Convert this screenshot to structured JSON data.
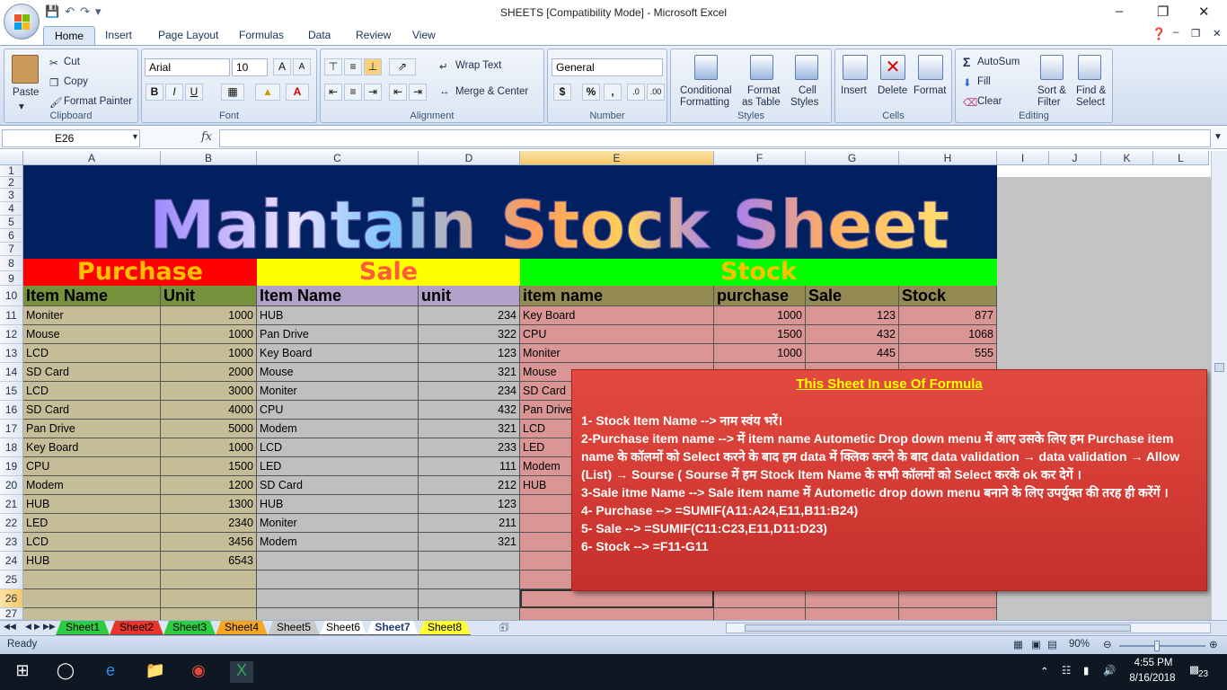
{
  "window": {
    "title": "SHEETS  [Compatibility Mode] - Microsoft Excel"
  },
  "tabs": [
    "Home",
    "Insert",
    "Page Layout",
    "Formulas",
    "Data",
    "Review",
    "View"
  ],
  "ribbon": {
    "clipboard": {
      "label": "Clipboard",
      "paste": "Paste",
      "cut": "Cut",
      "copy": "Copy",
      "format_painter": "Format Painter"
    },
    "font": {
      "label": "Font",
      "font_name": "Arial",
      "font_size": "10",
      "bold": "B",
      "italic": "I",
      "underline": "U"
    },
    "alignment": {
      "label": "Alignment",
      "wrap_text": "Wrap Text",
      "merge_center": "Merge & Center"
    },
    "number": {
      "label": "Number",
      "format": "General",
      "currency": "$",
      "percent": "%",
      "comma": ","
    },
    "styles": {
      "label": "Styles",
      "conditional": "Conditional",
      "formatting": "Formatting",
      "format": "Format",
      "as_table": "as Table",
      "cell": "Cell",
      "styles_word": "Styles"
    },
    "cells": {
      "label": "Cells",
      "insert": "Insert",
      "delete": "Delete",
      "format": "Format"
    },
    "editing": {
      "label": "Editing",
      "autosum": "AutoSum",
      "fill": "Fill",
      "clear": "Clear",
      "sort": "Sort &",
      "filter": "Filter",
      "find": "Find &",
      "select": "Select"
    }
  },
  "formula_bar": {
    "name_box": "E26",
    "fx": "fx",
    "value": ""
  },
  "columns": [
    "A",
    "B",
    "C",
    "D",
    "E",
    "F",
    "G",
    "H",
    "I",
    "J",
    "K",
    "L"
  ],
  "rows": [
    "1",
    "2",
    "3",
    "4",
    "5",
    "6",
    "7",
    "8",
    "9",
    "10",
    "11",
    "12",
    "13",
    "14",
    "15",
    "16",
    "17",
    "18",
    "19",
    "20",
    "21",
    "22",
    "23",
    "24",
    "25",
    "26",
    "27"
  ],
  "banner": {
    "title": "Maintain Stock Sheet"
  },
  "sections": {
    "purchase": "Purchase",
    "sale": "Sale",
    "stock": "Stock"
  },
  "headers": {
    "purchase": [
      "Item  Name",
      "Unit"
    ],
    "sale": [
      "Item Name",
      "unit"
    ],
    "stock": [
      "item name",
      "purchase",
      "Sale",
      "Stock"
    ]
  },
  "purchase_rows": [
    [
      "Moniter",
      "1000"
    ],
    [
      "Mouse",
      "1000"
    ],
    [
      "LCD",
      "1000"
    ],
    [
      "SD Card",
      "2000"
    ],
    [
      "LCD",
      "3000"
    ],
    [
      "SD Card",
      "4000"
    ],
    [
      "Pan Drive",
      "5000"
    ],
    [
      "Key Board",
      "1000"
    ],
    [
      "CPU",
      "1500"
    ],
    [
      "Modem",
      "1200"
    ],
    [
      "HUB",
      "1300"
    ],
    [
      "LED",
      "2340"
    ],
    [
      "LCD",
      "3456"
    ],
    [
      "HUB",
      "6543"
    ]
  ],
  "sale_rows": [
    [
      "HUB",
      "234"
    ],
    [
      "Pan Drive",
      "322"
    ],
    [
      "Key Board",
      "123"
    ],
    [
      "Mouse",
      "321"
    ],
    [
      "Moniter",
      "234"
    ],
    [
      "CPU",
      "432"
    ],
    [
      "Modem",
      "321"
    ],
    [
      "LCD",
      "233"
    ],
    [
      "LED",
      "111"
    ],
    [
      "SD Card",
      "212"
    ],
    [
      "HUB",
      "123"
    ],
    [
      "Moniter",
      "211"
    ],
    [
      "Modem",
      "321"
    ]
  ],
  "stock_rows": [
    [
      "Key Board",
      "1000",
      "123",
      "877"
    ],
    [
      "CPU",
      "1500",
      "432",
      "1068"
    ],
    [
      "Moniter",
      "1000",
      "445",
      "555"
    ],
    [
      "Mouse",
      "",
      "",
      ""
    ],
    [
      "SD Card",
      "",
      "",
      ""
    ],
    [
      "Pan Drive",
      "",
      "",
      ""
    ],
    [
      "LCD",
      "",
      "",
      ""
    ],
    [
      "LED",
      "",
      "",
      ""
    ],
    [
      "Modem",
      "",
      "",
      ""
    ],
    [
      "HUB",
      "",
      "",
      ""
    ]
  ],
  "note": {
    "title": "This  Sheet In use Of Formula",
    "lines": [
      "1- Stock Item Name    -->   नाम स्वंय भरें।",
      "2-Purchase item name    --> में item name Autometic Drop down menu  में आए उसके लिए   हम Purchase item name के कॉलमों को Select करने के बाद हम data  में  क्लिक करने के बाद data validation  → data validation  → Allow (List)  → Sourse ( Sourse में हम Stock Item Name के सभी कॉलमों को  Select करके ok  कर देगें ।",
      "3-Sale itme Name -->  Sale item name में Autometic drop down menu बनाने के लिए उपर्युक्त की तरह ही करेंगें ।",
      "4- Purchase --> =SUMIF(A11:A24,E11,B11:B24)",
      "5-  Sale  -->       =SUMIF(C11:C23,E11,D11:D23)",
      "6- Stock  -->       =F11-G11"
    ]
  },
  "sheet_tabs": [
    {
      "name": "Sheet1",
      "color": "#2ecc40"
    },
    {
      "name": "Sheet2",
      "color": "#e8342c"
    },
    {
      "name": "Sheet3",
      "color": "#2ecc40"
    },
    {
      "name": "Sheet4",
      "color": "#f5a623"
    },
    {
      "name": "Sheet5",
      "color": "#c8c8c8"
    },
    {
      "name": "Sheet6",
      "color": "#ffffff"
    },
    {
      "name": "Sheet7",
      "color": "#ffffff"
    },
    {
      "name": "Sheet8",
      "color": "#ffff33"
    }
  ],
  "active_sheet": "Sheet7",
  "status": {
    "ready": "Ready",
    "zoom": "90%"
  },
  "taskbar": {
    "time": "4:55 PM",
    "date": "8/16/2018",
    "notifications": "23"
  }
}
